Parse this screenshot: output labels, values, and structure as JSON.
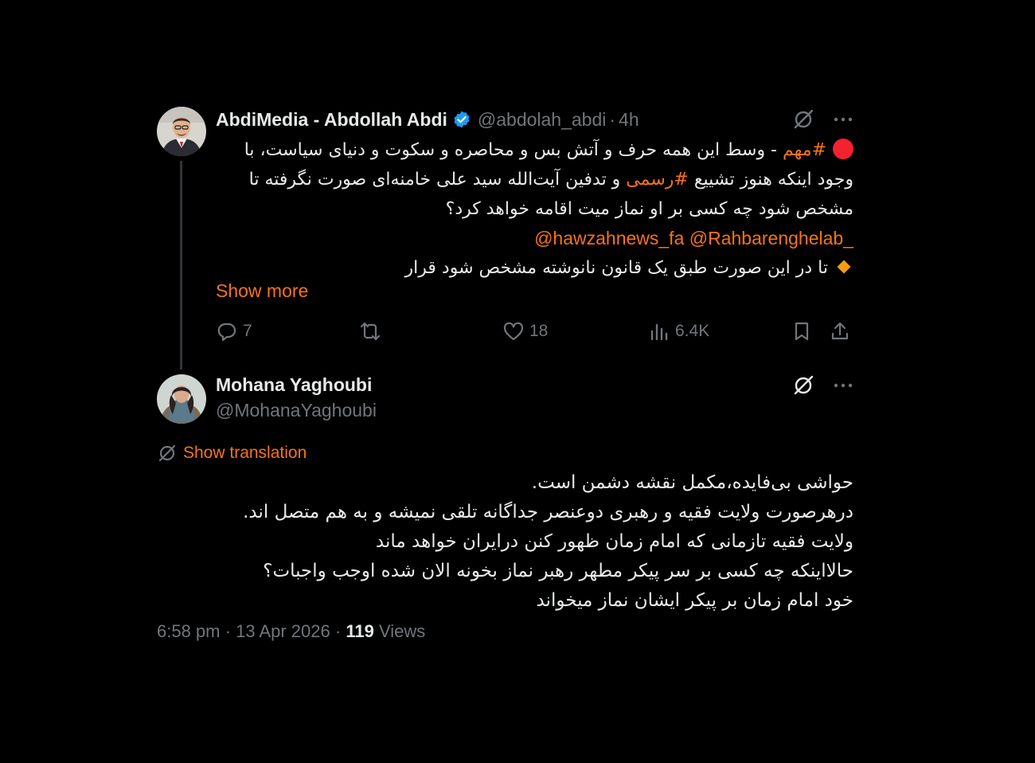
{
  "colors": {
    "background": "#000000",
    "accent": "#f97316",
    "muted": "#71767b",
    "verified": "#1d9bf0",
    "alert_dot": "#f4212e"
  },
  "parent_tweet": {
    "author_name": "AbdiMedia - Abdollah Abdi",
    "verified_icon": "verified-badge-icon",
    "handle": "@abdolah_abdi",
    "separator": "·",
    "time": "4h",
    "line1_dot_icon": "red-circle-emoji",
    "line1_hashtag": "#مهم",
    "line1_text": " - وسط این همه حرف و آتش بس و محاصره و سکوت و دنیای سیاست، با",
    "line2_pre": "وجود اینکه هنوز تشییع ",
    "line2_hashtag": "#رسمی",
    "line2_post": " و تدفین آیت‌الله سید علی خامنه‌ای صورت نگرفته تا",
    "line3": "مشخص شود چه کسی بر او نماز میت اقامه خواهد کرد؟",
    "mention1": "@Rahbarenghelab_",
    "mention2": "@hawzahnews_fa",
    "line5_icon": "orange-diamond-emoji",
    "line5": "تا در این صورت طبق یک قانون نانوشته مشخص شود قرار",
    "show_more": "Show more",
    "replies": "7",
    "likes": "18",
    "views": "6.4K"
  },
  "reply_tweet": {
    "author_name": "Mohana Yaghoubi",
    "handle": "@MohanaYaghoubi",
    "show_translation": "Show translation",
    "lines": [
      "حواشی بی‌فایده،مکمل نقشه دشمن است.",
      "درهرصورت ولایت فقیه و رهبری دوعنصر جداگانه تلقی نمیشه و به هم متصل اند.",
      "ولایت فقیه تازمانی که امام زمان ظهور کنن درایران خواهد ماند",
      "حالااینکه چه کسی بر سر پیکر مطهر رهبر نماز بخونه الان شده اوجب واجبات؟",
      "خود امام زمان بر پیکر ایشان نماز میخواند"
    ],
    "time": "6:58 pm",
    "date": "13 Apr 2026",
    "separator": "·",
    "views_count": "119",
    "views_label": "Views"
  }
}
